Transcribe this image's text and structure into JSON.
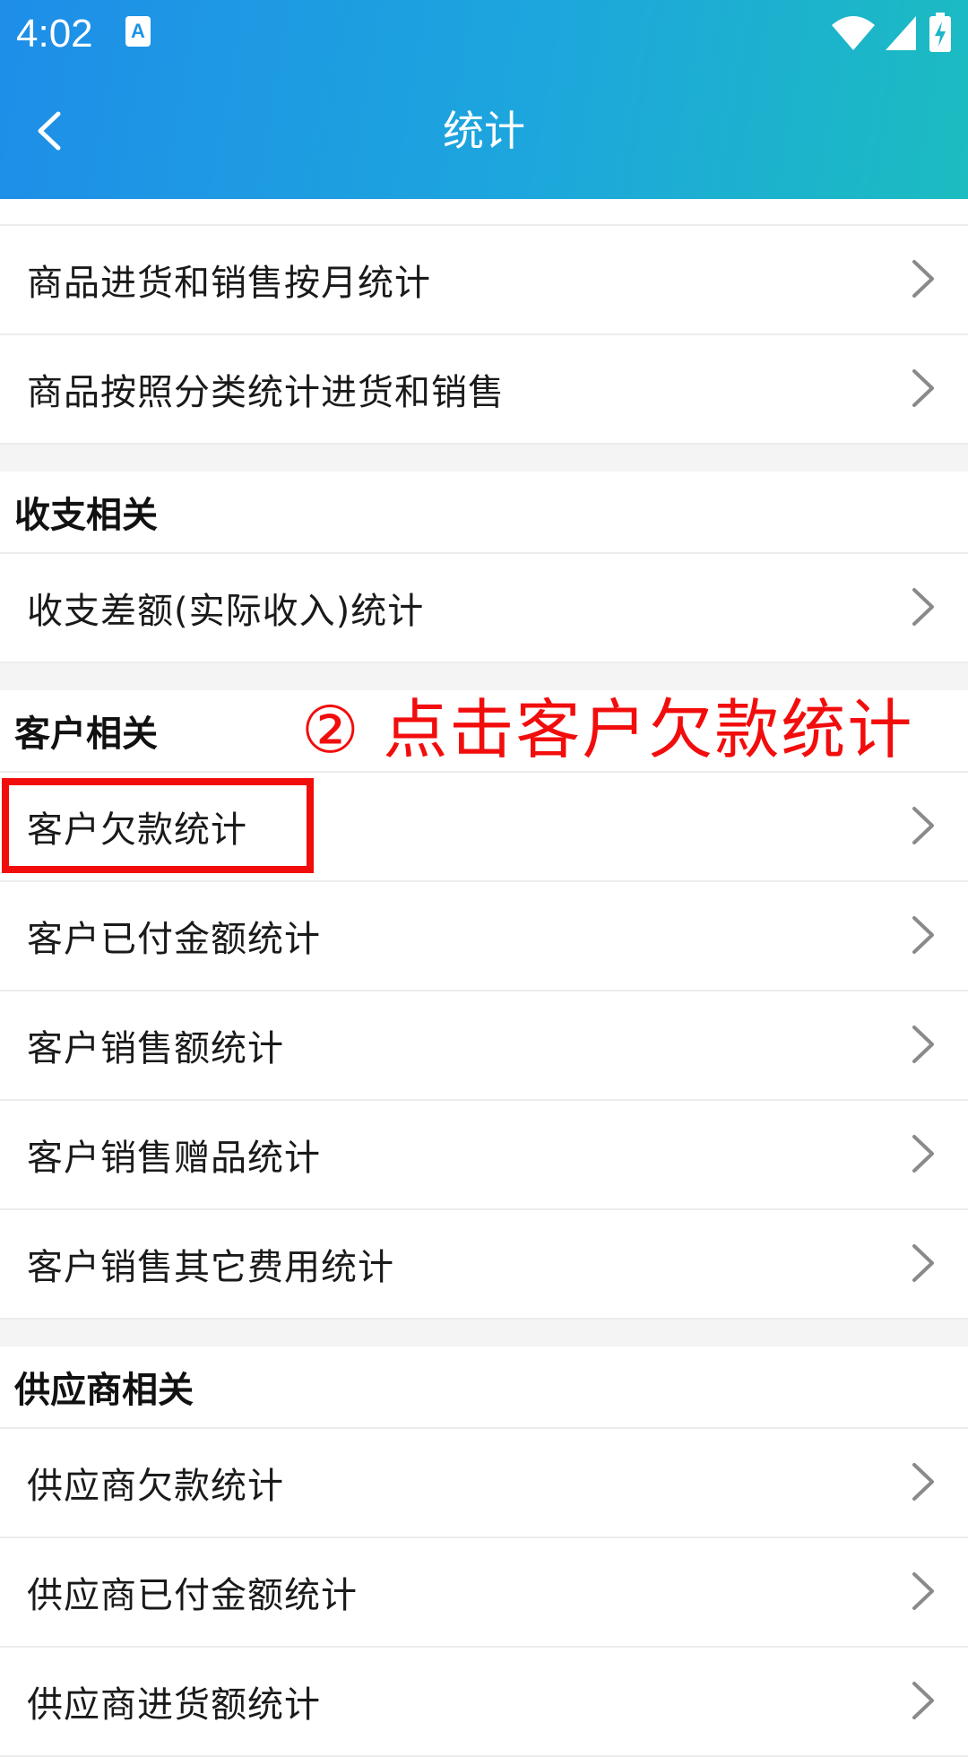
{
  "status_bar": {
    "time": "4:02",
    "app_icon": "A",
    "icons": [
      "wifi-icon",
      "signal-icon",
      "battery-charging-icon"
    ]
  },
  "app_bar": {
    "title": "统计",
    "back_icon": "back-chevron-icon",
    "gradient": [
      "#1e8ee8",
      "#1cbcc1"
    ]
  },
  "sections": [
    {
      "header": "",
      "items": [
        "商品进货和销售按月统计",
        "商品按照分类统计进货和销售"
      ]
    },
    {
      "header": "收支相关",
      "items": [
        "收支差额(实际收入)统计"
      ]
    },
    {
      "header": "客户相关",
      "items": [
        "客户欠款统计",
        "客户已付金额统计",
        "客户销售额统计",
        "客户销售赠品统计",
        "客户销售其它费用统计"
      ]
    },
    {
      "header": "供应商相关",
      "items": [
        "供应商欠款统计",
        "供应商已付金额统计",
        "供应商进货额统计"
      ]
    }
  ],
  "annotation": {
    "text": "② 点击客户欠款统计",
    "color": "#f20d0d"
  },
  "row_chevron_icon": "chevron-right-icon"
}
